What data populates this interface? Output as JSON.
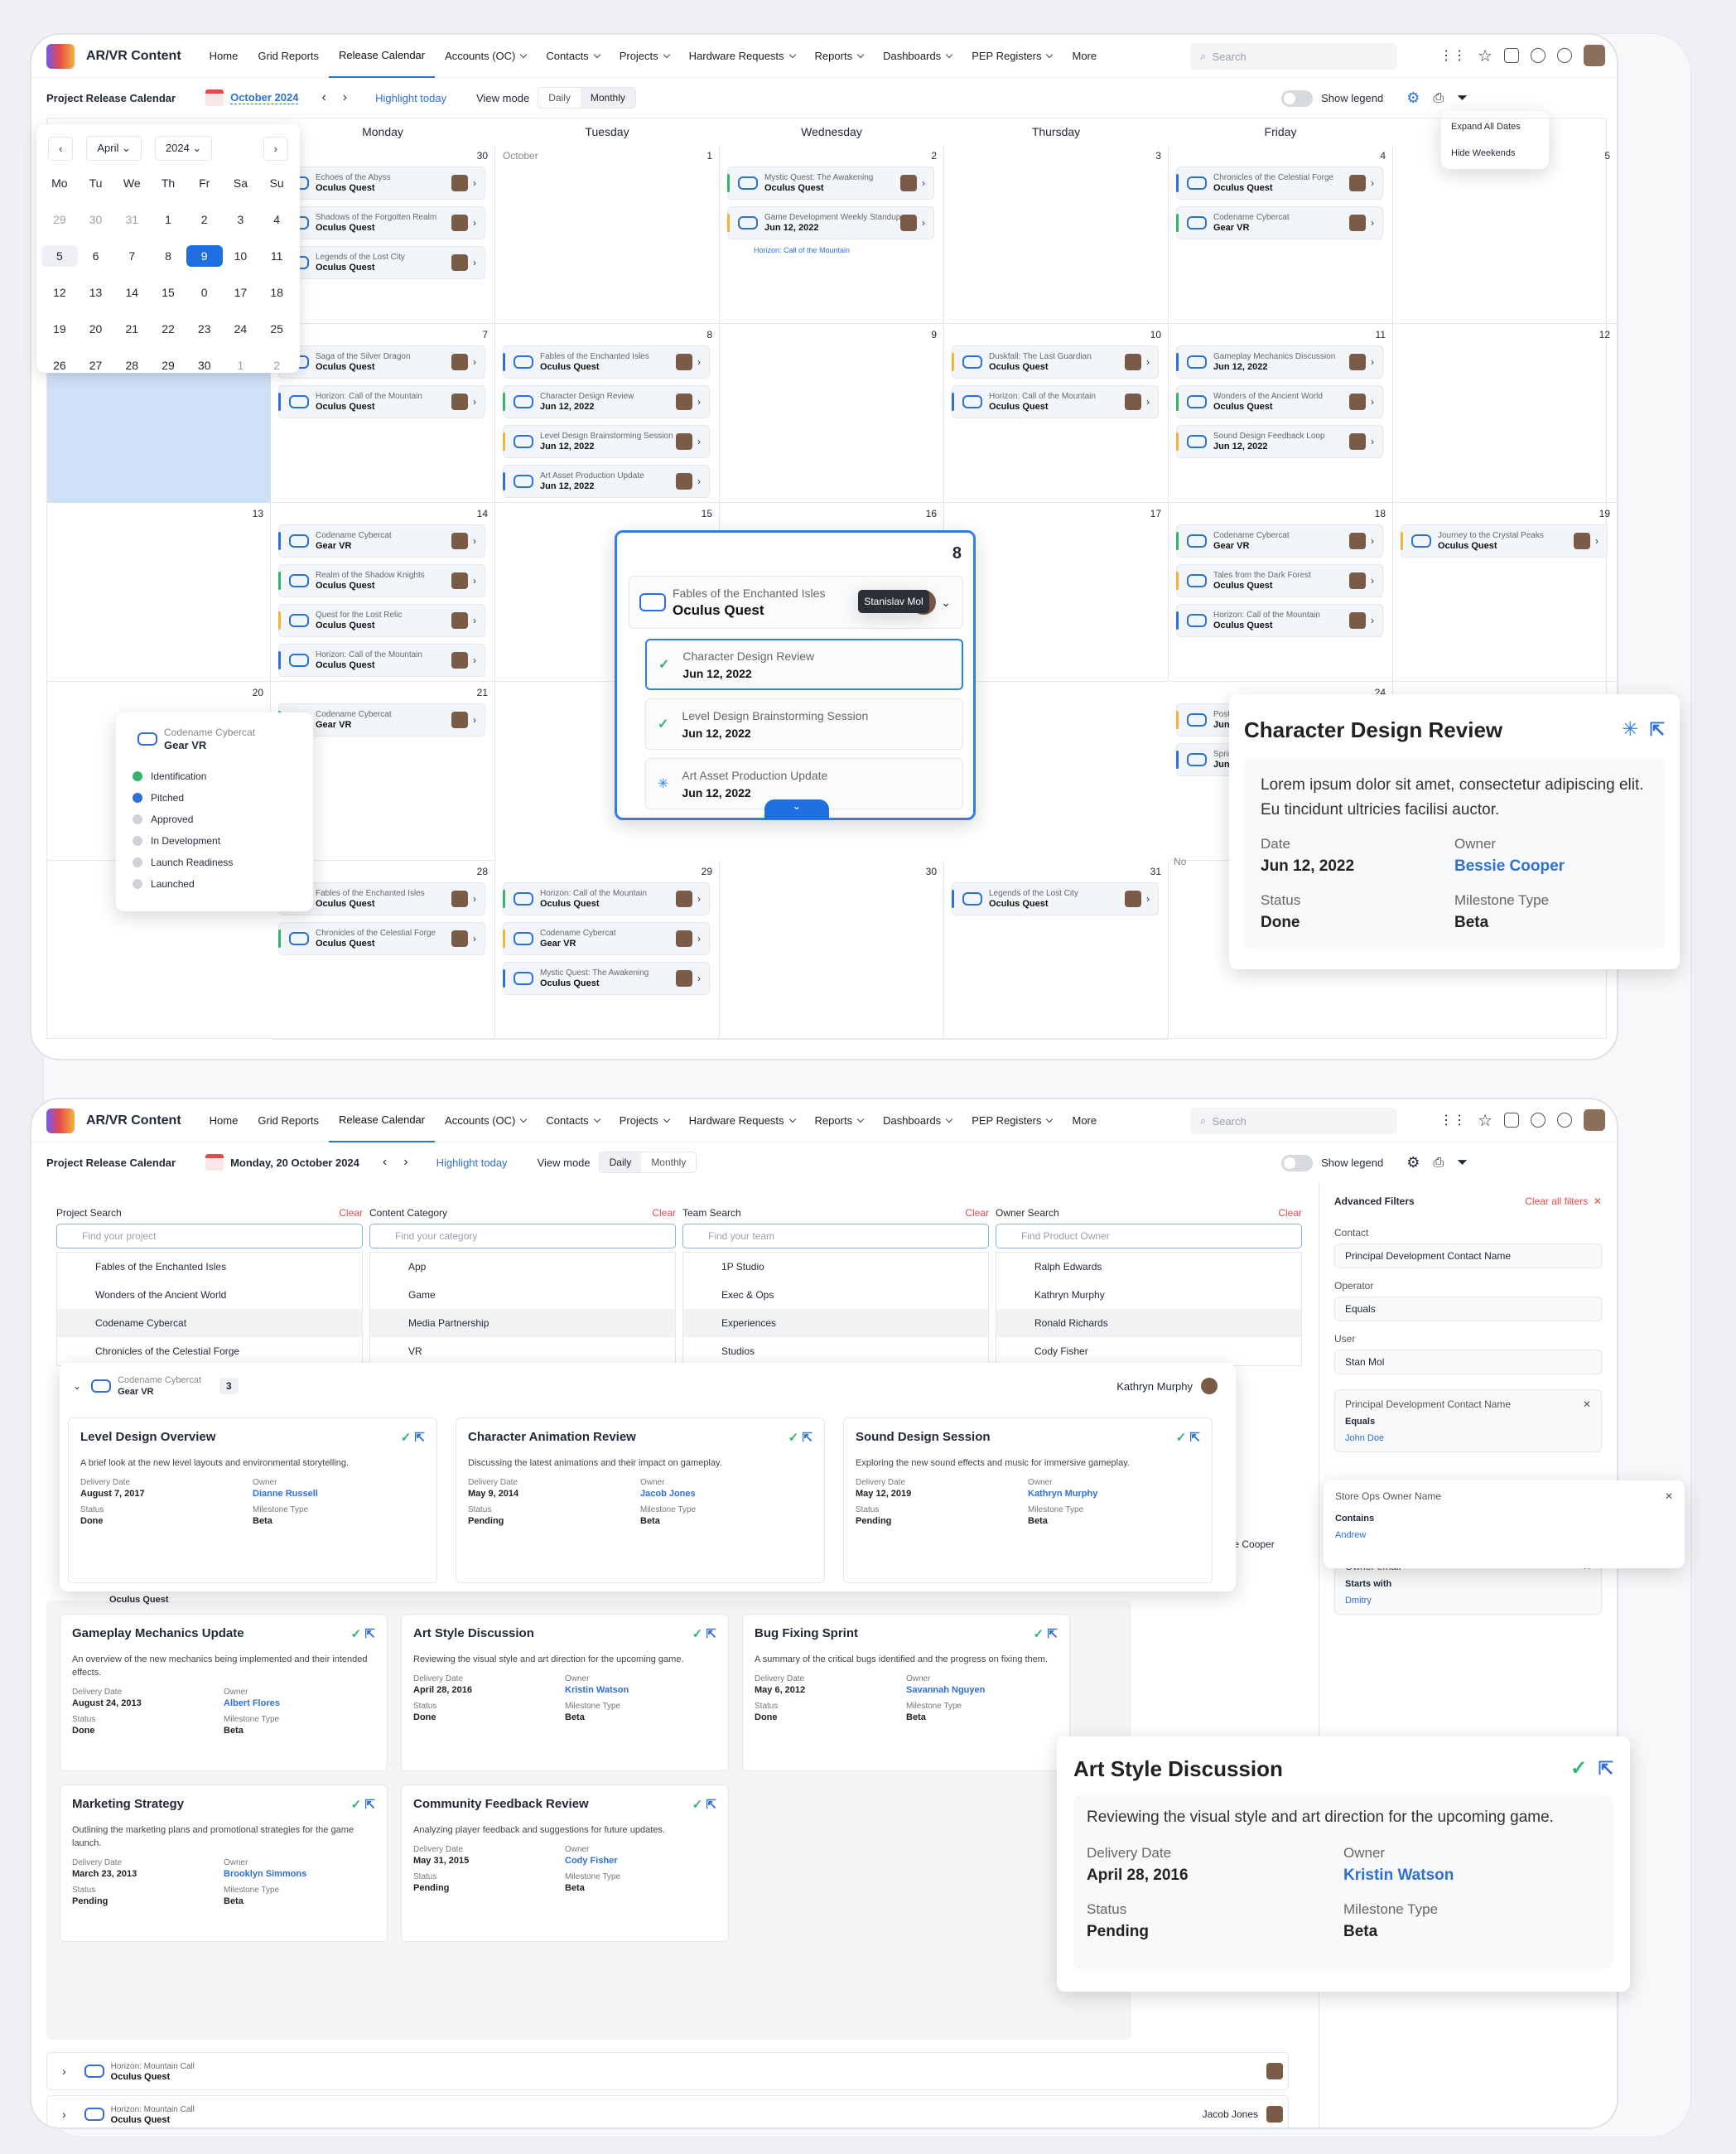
{
  "app": {
    "title": "AR/VR Content",
    "nav": [
      "Home",
      "Grid Reports",
      "Release Calendar",
      "Accounts (OC)",
      "Contacts",
      "Projects",
      "Hardware Requests",
      "Reports",
      "Dashboards",
      "PEP Registers",
      "More"
    ],
    "search": "Search"
  },
  "monthly": {
    "page_title": "Project Release Calendar",
    "date": "October 2024",
    "highlight": "Highlight today",
    "view_mode": "View mode",
    "daily": "Daily",
    "monthly": "Monthly",
    "legend": "Show legend",
    "menu": [
      "Expand All Dates",
      "Hide Weekends"
    ],
    "days": [
      "Monday",
      "Tuesday",
      "Wednesday",
      "Thursday",
      "Friday"
    ],
    "mini": {
      "month": "April",
      "year": "2024",
      "dow": [
        "Mo",
        "Tu",
        "We",
        "Th",
        "Fr",
        "Sa",
        "Su"
      ],
      "dates": [
        "29",
        "30",
        "31",
        "1",
        "2",
        "3",
        "4",
        "5",
        "6",
        "7",
        "8",
        "9",
        "10",
        "11",
        "12",
        "13",
        "14",
        "15",
        "0",
        "17",
        "18",
        "19",
        "20",
        "21",
        "22",
        "23",
        "24",
        "25",
        "26",
        "27",
        "28",
        "29",
        "30",
        "1",
        "2"
      ]
    },
    "cells": [
      {
        "n": "30",
        "cards": [
          [
            "Echoes of the Abyss",
            "Oculus Quest"
          ],
          [
            "Shadows of the Forgotten Realm",
            "Oculus Quest"
          ],
          [
            "Legends of the Lost City",
            "Oculus Quest"
          ]
        ]
      },
      {
        "n": "1",
        "label": "October",
        "cards": []
      },
      {
        "n": "2",
        "cards": [
          [
            "Mystic Quest: The Awakening",
            "Oculus Quest"
          ],
          [
            "Game Development Weekly Standup",
            "Jun 12, 2022"
          ]
        ],
        "link": "Horizon: Call of the Mountain"
      },
      {
        "n": "3",
        "cards": []
      },
      {
        "n": "4",
        "cards": [
          [
            "Chronicles of the Celestial Forge",
            "Oculus Quest"
          ],
          [
            "Codename Cybercat",
            "Gear VR"
          ]
        ]
      },
      {
        "n": "5",
        "cards": []
      },
      {
        "n": "7",
        "cards": [
          [
            "Saga of the Silver Dragon",
            "Oculus Quest"
          ],
          [
            "Horizon: Call of the Mountain",
            "Oculus Quest"
          ]
        ]
      },
      {
        "n": "8",
        "cards": [
          [
            "Fables of the Enchanted Isles",
            "Oculus Quest"
          ],
          [
            "Character Design Review",
            "Jun 12, 2022"
          ],
          [
            "Level Design Brainstorming Session",
            "Jun 12, 2022"
          ],
          [
            "Art Asset Production Update",
            "Jun 12, 2022"
          ]
        ]
      },
      {
        "n": "9",
        "cards": []
      },
      {
        "n": "10",
        "cards": [
          [
            "Duskfall: The Last Guardian",
            "Oculus Quest"
          ],
          [
            "Horizon: Call of the Mountain",
            "Oculus Quest"
          ]
        ]
      },
      {
        "n": "11",
        "cards": [
          [
            "Gameplay Mechanics Discussion",
            "Jun 12, 2022"
          ],
          [
            "Wonders of the Ancient World",
            "Oculus Quest"
          ],
          [
            "Sound Design Feedback Loop",
            "Jun 12, 2022"
          ]
        ]
      },
      {
        "n": "12",
        "cards": []
      },
      {
        "n": "13",
        "cards": []
      },
      {
        "n": "14",
        "cards": [
          [
            "Codename Cybercat",
            "Gear VR"
          ],
          [
            "Realm of the Shadow Knights",
            "Oculus Quest"
          ],
          [
            "Quest for the Lost Relic",
            "Oculus Quest"
          ],
          [
            "Horizon: Call of the Mountain",
            "Oculus Quest"
          ]
        ]
      },
      {
        "n": "15",
        "cards": []
      },
      {
        "n": "16",
        "cards": []
      },
      {
        "n": "17",
        "cards": []
      },
      {
        "n": "18",
        "cards": [
          [
            "Codename Cybercat",
            "Gear VR"
          ],
          [
            "Tales from the Dark Forest",
            "Oculus Quest"
          ],
          [
            "Horizon: Call of the Mountain",
            "Oculus Quest"
          ]
        ]
      },
      {
        "n": "19",
        "cards": [
          [
            "Journey to the Crystal Peaks",
            "Oculus Quest"
          ]
        ]
      },
      {
        "n": "20",
        "cards": []
      },
      {
        "n": "21",
        "cards": [
          [
            "Codename Cybercat",
            "Gear VR"
          ]
        ]
      },
      {
        "n": "24",
        "cards": [
          [
            "Post-Mortem Analysis of Game Jam",
            "Jun 12, 2022"
          ],
          [
            "Sprint Planning for Next Milestone",
            "Jun 12, 2022"
          ]
        ]
      },
      {
        "n": "28",
        "cards": [
          [
            "Fables of the Enchanted Isles",
            "Oculus Quest"
          ],
          [
            "Chronicles of the Celestial Forge",
            "Oculus Quest"
          ]
        ]
      },
      {
        "n": "29",
        "cards": [
          [
            "Horizon: Call of the Mountain",
            "Oculus Quest"
          ],
          [
            "Codename Cybercat",
            "Gear VR"
          ],
          [
            "Mystic Quest: The Awakening",
            "Oculus Quest"
          ]
        ]
      },
      {
        "n": "30",
        "cards": []
      },
      {
        "n": "31",
        "cards": [
          [
            "Legends of the Lost City",
            "Oculus Quest"
          ]
        ]
      }
    ],
    "link2": "Codename Cybercat",
    "tooltip": "Stanislav Mol",
    "expanded": {
      "n": "8",
      "title": "Fables of the Enchanted Isles",
      "platform": "Oculus Quest",
      "items": [
        [
          "Character Design Review",
          "Jun 12, 2022"
        ],
        [
          "Level Design Brainstorming Session",
          "Jun 12, 2022"
        ],
        [
          "Art Asset Production Update",
          "Jun 12, 2022"
        ]
      ]
    },
    "stages": {
      "title": "Codename Cybercat",
      "platform": "Gear VR",
      "items": [
        "Identification",
        "Pitched",
        "Approved",
        "In Development",
        "Launch Readiness",
        "Launched"
      ]
    },
    "detail": {
      "title": "Character Design Review",
      "desc": "Lorem ipsum dolor sit amet, consectetur adipiscing elit. Eu tincidunt ultricies facilisi auctor.",
      "date_l": "Date",
      "date": "Jun 12, 2022",
      "owner_l": "Owner",
      "owner": "Bessie Cooper",
      "status_l": "Status",
      "status": "Done",
      "ms_l": "Milestone Type",
      "ms": "Beta"
    },
    "no": "No"
  },
  "daily": {
    "date": "Monday, 20 October 2024",
    "filters": [
      {
        "label": "Project Search",
        "ph": "Find your project",
        "items": [
          "Fables of the Enchanted Isles",
          "Wonders of the Ancient World",
          "Codename Cybercat",
          "Chronicles of the Celestial Forge"
        ]
      },
      {
        "label": "Content Category",
        "ph": "Find your category",
        "items": [
          "App",
          "Game",
          "Media Partnership",
          "VR"
        ]
      },
      {
        "label": "Team Search",
        "ph": "Find your team",
        "items": [
          "1P Studio",
          "Exec & Ops",
          "Experiences",
          "Studios"
        ]
      },
      {
        "label": "Owner Search",
        "ph": "Find Product Owner",
        "items": [
          "Ralph Edwards",
          "Kathryn Murphy",
          "Ronald Richards",
          "Cody Fisher"
        ]
      }
    ],
    "clear": "Clear",
    "adv": {
      "title": "Advanced Filters",
      "clear_all": "Clear all filters",
      "contact_l": "Contact",
      "contact": "Principal Development Contact Name",
      "operator_l": "Operator",
      "operator": "Equals",
      "user_l": "User",
      "user": "Stan Mol",
      "f1": {
        "name": "Principal Development Contact Name",
        "op": "Equals",
        "val": "John Doe"
      },
      "f2": {
        "name": "Store Ops Owner Name",
        "op": "Contains",
        "val": "Andrew"
      },
      "f3": {
        "name": "Owner email",
        "op": "Starts with",
        "val": "Dmitry"
      }
    },
    "group": {
      "title": "Codename Cybercat",
      "platform": "Gear VR",
      "count": "3",
      "owner": "Kathryn Murphy"
    },
    "under": "Oculus Quest",
    "bessie": "Bessie Cooper",
    "tasks1": [
      {
        "t": "Level Design Overview",
        "d": "A brief look at the new level layouts and environmental storytelling.",
        "date": "August 7, 2017",
        "owner": "Dianne Russell",
        "status": "Done",
        "ms": "Beta"
      },
      {
        "t": "Character Animation Review",
        "d": "Discussing the latest animations and their impact on gameplay.",
        "date": "May 9, 2014",
        "owner": "Jacob Jones",
        "status": "Pending",
        "ms": "Beta"
      },
      {
        "t": "Sound Design Session",
        "d": "Exploring the new sound effects and music for immersive gameplay.",
        "date": "May 12, 2019",
        "owner": "Kathryn Murphy",
        "status": "Pending",
        "ms": "Beta"
      }
    ],
    "tasks2": [
      {
        "t": "Gameplay Mechanics Update",
        "d": "An overview of the new mechanics being implemented and their intended effects.",
        "date": "August 24, 2013",
        "owner": "Albert Flores",
        "status": "Done",
        "ms": "Beta"
      },
      {
        "t": "Art Style Discussion",
        "d": "Reviewing the visual style and art direction for the upcoming game.",
        "date": "April 28, 2016",
        "owner": "Kristin Watson",
        "status": "Done",
        "ms": "Beta"
      },
      {
        "t": "Bug Fixing Sprint",
        "d": "A summary of the critical bugs identified and the progress on fixing them.",
        "date": "May 6, 2012",
        "owner": "Savannah Nguyen",
        "status": "Done",
        "ms": "Beta"
      },
      {
        "t": "Marketing Strategy",
        "d": "Outlining the marketing plans and promotional strategies for the game launch.",
        "date": "March 23, 2013",
        "owner": "Brooklyn Simmons",
        "status": "Pending",
        "ms": "Beta"
      },
      {
        "t": "Community Feedback Review",
        "d": "Analyzing player feedback and suggestions for future updates.",
        "date": "May 31, 2015",
        "owner": "Cody Fisher",
        "status": "Pending",
        "ms": "Beta"
      }
    ],
    "labels": {
      "delivery": "Delivery Date",
      "owner": "Owner",
      "status": "Status",
      "ms": "Milestone Type"
    },
    "big": {
      "t": "Art Style Discussion",
      "d": "Reviewing the visual style and art direction for the upcoming game.",
      "date": "April 28, 2016",
      "owner": "Kristin Watson",
      "status": "Pending",
      "ms": "Beta"
    },
    "rows": [
      {
        "t": "Horizon: Mountain Call",
        "p": "Oculus Quest",
        "o": ""
      },
      {
        "t": "Horizon: Mountain Call",
        "p": "Oculus Quest",
        "o": "Jacob Jones"
      },
      {
        "t": "Horizon: Mountain Call",
        "p": "Oculus Quest",
        "o": "Ralph Edwards"
      }
    ]
  }
}
